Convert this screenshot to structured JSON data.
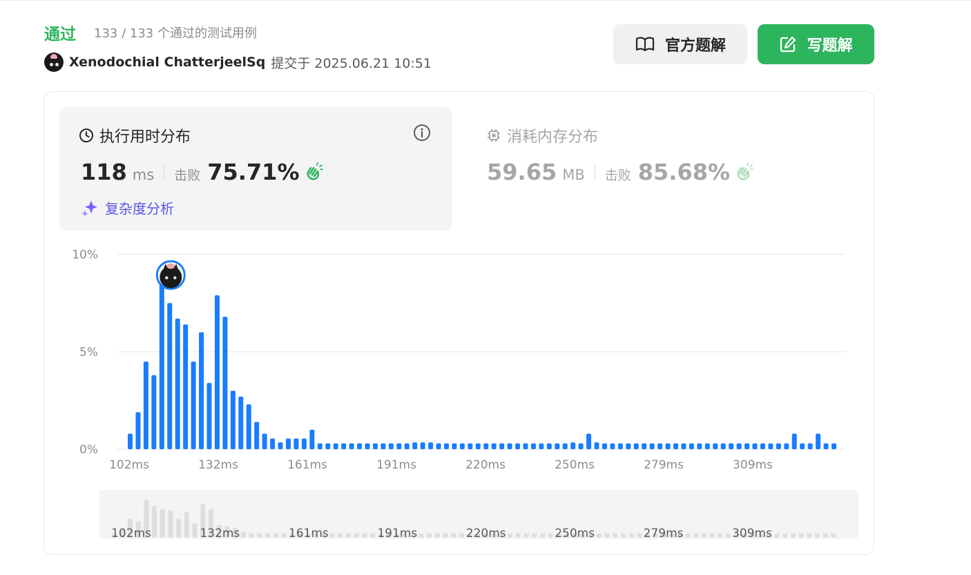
{
  "header": {
    "status": "通过",
    "pass_count": "133 / 133 个通过的测试用例",
    "username": "Xenodochial ChatterjeelSq",
    "submitted_at": "提交于 2025.06.21 10:51"
  },
  "actions": {
    "official_solution": "官方题解",
    "write_solution": "写题解"
  },
  "runtime": {
    "title": "执行用时分布",
    "value": "118",
    "unit": "ms",
    "beats_label": "击败",
    "beats_pct": "75.71%",
    "analysis_link": "复杂度分析"
  },
  "memory": {
    "title": "消耗内存分布",
    "value": "59.65",
    "unit": "MB",
    "beats_label": "击败",
    "beats_pct": "85.68%"
  },
  "colors": {
    "accent_green": "#2db55d",
    "bar_blue": "#1a7cff",
    "analysis_purple": "#5b55e6",
    "mini_bar": "#dedede"
  },
  "icons": [
    "book-icon",
    "edit-icon",
    "clock-icon",
    "info-icon",
    "chip-icon",
    "clap-icon",
    "sparkle-icon",
    "user-avatar"
  ],
  "chart_data": {
    "type": "bar",
    "title": "",
    "xlabel": "",
    "ylabel": "",
    "ylim": [
      0,
      10
    ],
    "y_ticks": [
      "0%",
      "5%",
      "10%"
    ],
    "x_tick_labels": [
      "102ms",
      "132ms",
      "161ms",
      "191ms",
      "220ms",
      "250ms",
      "279ms",
      "309ms"
    ],
    "highlight_index": 4,
    "values": [
      0.8,
      1.9,
      4.5,
      3.8,
      9.0,
      7.5,
      6.7,
      6.4,
      4.5,
      6.0,
      3.4,
      7.9,
      6.8,
      3.0,
      2.7,
      2.3,
      1.4,
      0.8,
      0.55,
      0.35,
      0.55,
      0.55,
      0.55,
      1.0,
      0.3,
      0.3,
      0.3,
      0.3,
      0.3,
      0.3,
      0.3,
      0.3,
      0.3,
      0.3,
      0.3,
      0.3,
      0.35,
      0.35,
      0.35,
      0.3,
      0.3,
      0.3,
      0.3,
      0.3,
      0.3,
      0.3,
      0.3,
      0.3,
      0.3,
      0.3,
      0.3,
      0.3,
      0.3,
      0.3,
      0.3,
      0.3,
      0.35,
      0.3,
      0.8,
      0.35,
      0.3,
      0.3,
      0.3,
      0.3,
      0.3,
      0.3,
      0.3,
      0.3,
      0.3,
      0.3,
      0.3,
      0.3,
      0.3,
      0.3,
      0.3,
      0.3,
      0.3,
      0.3,
      0.3,
      0.3,
      0.3,
      0.3,
      0.3,
      0.3,
      0.8,
      0.3,
      0.3,
      0.8,
      0.3,
      0.3
    ]
  }
}
